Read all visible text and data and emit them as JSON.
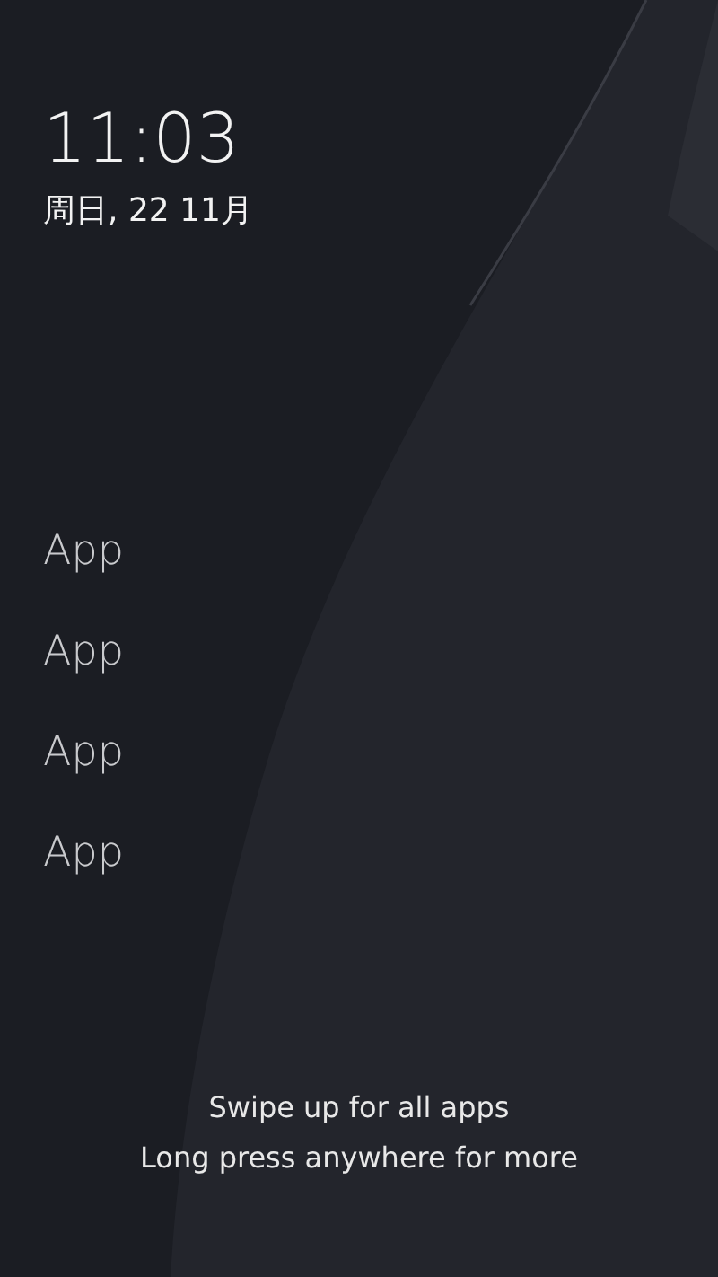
{
  "clock": {
    "time": "11:03",
    "date": "周日, 22 11月"
  },
  "apps": [
    {
      "label": "App"
    },
    {
      "label": "App"
    },
    {
      "label": "App"
    },
    {
      "label": "App"
    }
  ],
  "hints": [
    "Swipe up for all apps",
    "Long press anywhere for more"
  ]
}
